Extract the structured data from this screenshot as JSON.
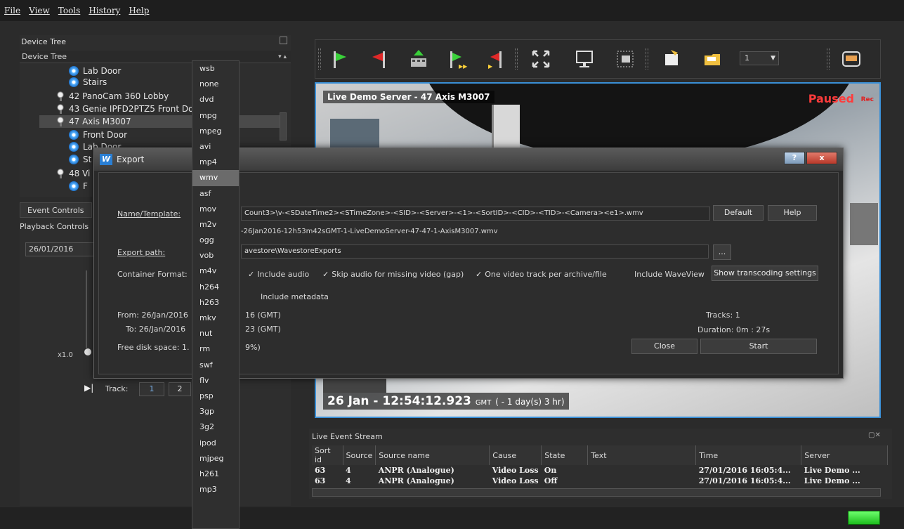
{
  "menu": [
    "File",
    "View",
    "Tools",
    "History",
    "Help"
  ],
  "device_tree": {
    "caption": "Device Tree",
    "combo_value": "Device Tree",
    "items": [
      {
        "label": "Lab Door",
        "icon": "eye-icon"
      },
      {
        "label": "Stairs",
        "icon": "eye-icon"
      },
      {
        "label": "42 PanoCam 360 Lobby",
        "icon": "camera-icon"
      },
      {
        "label": "43 Genie IPFD2PTZ5 Front Do",
        "icon": "camera-icon"
      },
      {
        "label": "47 Axis M3007",
        "icon": "camera-icon"
      },
      {
        "label": "Front Door",
        "icon": "eye-icon"
      },
      {
        "label": "Lab Door",
        "icon": "eye-icon"
      },
      {
        "label": "St",
        "icon": "eye-icon"
      },
      {
        "label": "48 Vi",
        "icon": "camera-icon"
      },
      {
        "label": "F",
        "icon": "eye-icon"
      }
    ]
  },
  "left_tabs": {
    "event_controls": "Event Controls",
    "playback_controls": "Playback Controls"
  },
  "playback": {
    "date": "26/01/2016",
    "speed": "x1.0",
    "track_label": "Track:",
    "tracks": [
      "1",
      "2"
    ]
  },
  "format_list": {
    "items": [
      "wsb",
      "none",
      "dvd",
      "mpg",
      "mpeg",
      "avi",
      "mp4",
      "wmv",
      "asf",
      "mov",
      "m2v",
      "ogg",
      "vob",
      "m4v",
      "h264",
      "h263",
      "mkv",
      "nut",
      "rm",
      "swf",
      "flv",
      "psp",
      "3gp",
      "3g2",
      "ipod",
      "mjpeg",
      "h261",
      "mp3"
    ],
    "selected": "wmv"
  },
  "toolbar": {
    "stream_select": "1"
  },
  "video": {
    "title": "Live Demo Server - 47 Axis M3007",
    "status": "Paused",
    "rec": "Rec",
    "timestamp_main": "26 Jan - 12:54:12.923",
    "timestamp_zone": "GMT",
    "timestamp_relative": "( - 1 day(s) 3 hr)"
  },
  "event_stream": {
    "caption": "Live Event Stream",
    "columns": [
      "Sort id",
      "Source",
      "Source name",
      "Cause",
      "State",
      "Text",
      "Time",
      "Server"
    ],
    "rows": [
      [
        "63",
        "4",
        "ANPR (Analogue)",
        "Video Loss",
        "On",
        "",
        "27/01/2016 16:05:4...",
        "Live Demo ..."
      ],
      [
        "63",
        "4",
        "ANPR (Analogue)",
        "Video Loss",
        "Off",
        "",
        "27/01/2016 16:05:4...",
        "Live Demo ..."
      ]
    ]
  },
  "export_dialog": {
    "title": "Export",
    "logo": "W",
    "help_q": "?",
    "close_x": "x",
    "name_label": "Name/Template:",
    "name_value": "Count3>\\v-<SDateTime2><STimeZone>-<SID>-<Server>-<1>-<SortID>-<CID>-<TID>-<Camera><e1>.wmv",
    "default_btn": "Default",
    "help_btn": "Help",
    "preview_name": "-26Jan2016-12h53m42sGMT-1-LiveDemoServer-47-47-1-AxisM3007.wmv",
    "path_label": "Export path:",
    "path_value": "avestore\\WavestoreExports",
    "browse_btn": "...",
    "container_label": "Container Format:",
    "include_audio": "Include audio",
    "skip_audio": "Skip audio for missing video (gap)",
    "one_track": "One video track per archive/file",
    "include_waveview": "Include WaveView",
    "transcode_btn": "Show transcoding settings",
    "include_metadata": "Include metadata",
    "from_label": "From: 26/Jan/2016",
    "from_tail": "16 (GMT)",
    "to_label": "To: 26/Jan/2016",
    "to_tail": "23 (GMT)",
    "free_label": "Free disk space: 1.",
    "free_tail": "9%)",
    "tracks": "Tracks: 1",
    "duration": "Duration: 0m : 27s",
    "close_btn": "Close",
    "start_btn": "Start"
  },
  "colors": {
    "accent": "#3a8fd6",
    "paused": "#ff3b3b",
    "status_ok": "#2ed22e"
  }
}
